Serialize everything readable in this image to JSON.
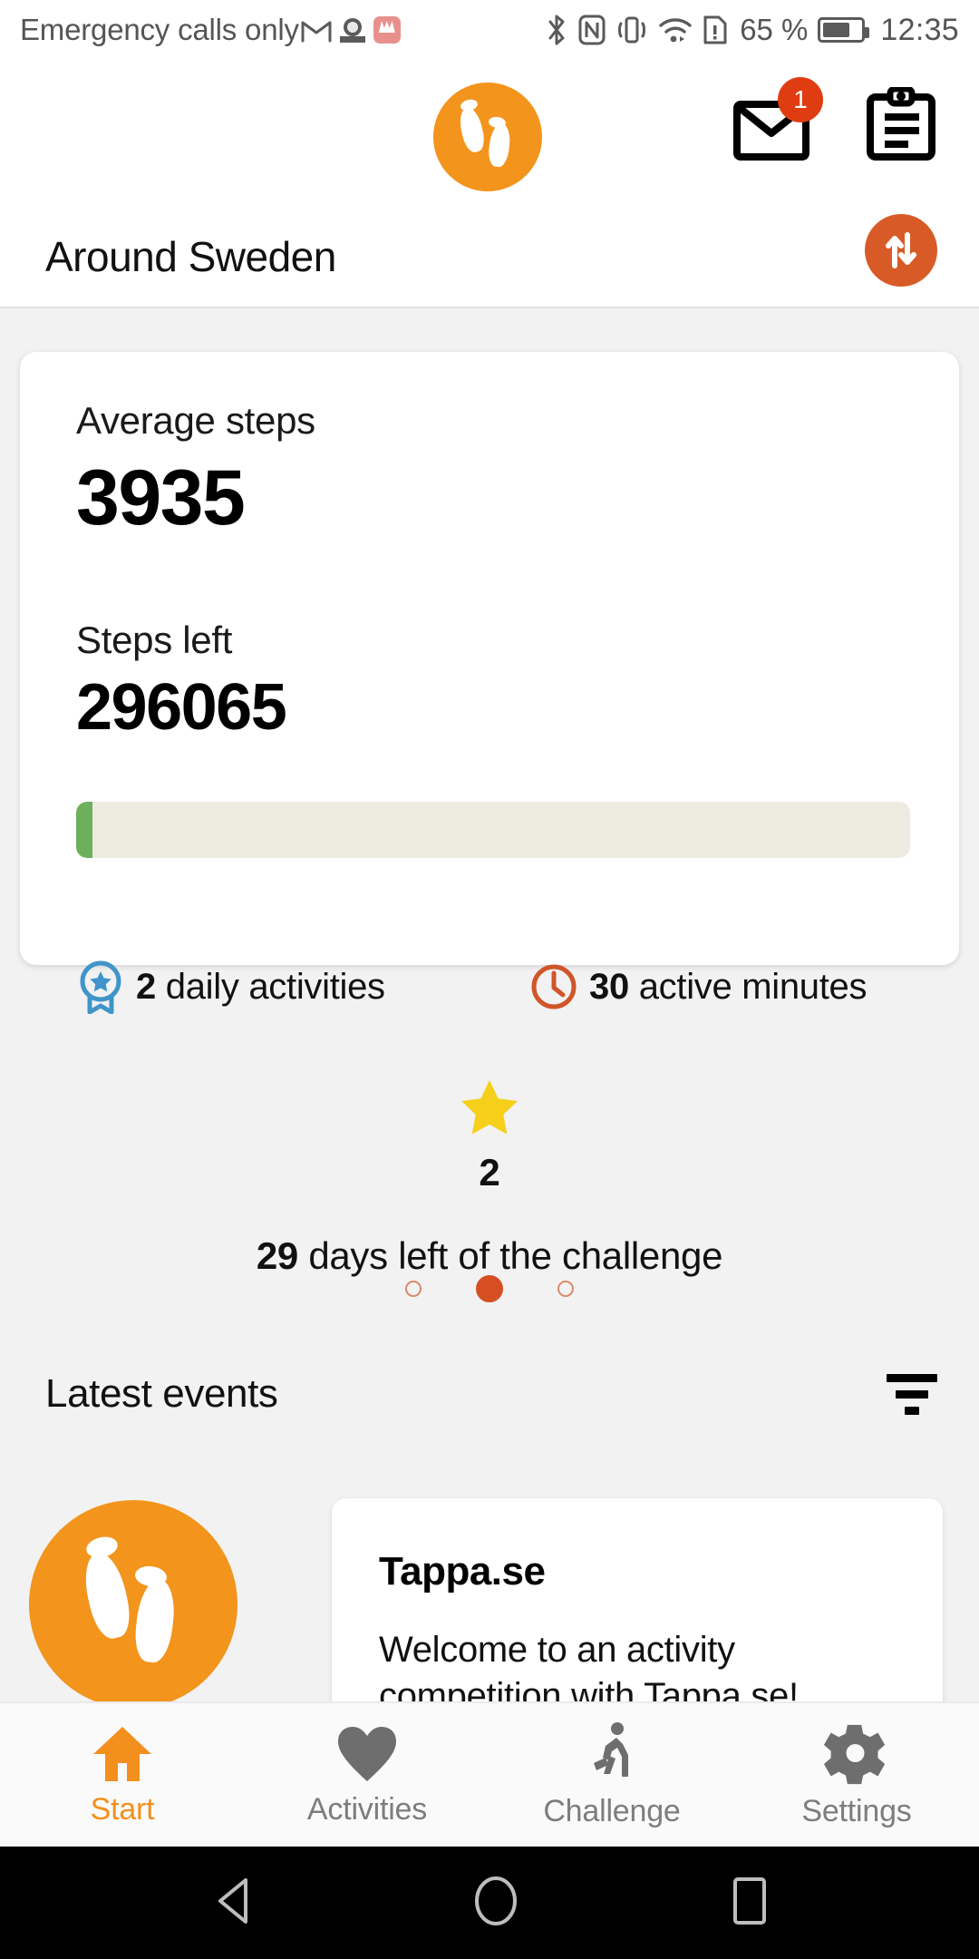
{
  "status_bar": {
    "carrier": "Emergency calls only",
    "left_icons": [
      "gmail-icon",
      "camera-icon",
      "huawei-icon"
    ],
    "right_icons": [
      "bluetooth-icon",
      "nfc-icon",
      "vibrate-icon",
      "wifi-icon",
      "sim-alert-icon"
    ],
    "battery_percent": "65 %",
    "battery_level": 65,
    "time": "12:35"
  },
  "header": {
    "logo_icon": "footprints-logo",
    "mail_icon": "mail-icon",
    "mail_badge": "1",
    "clipboard_icon": "clipboard-icon",
    "challenge_title": "Around Sweden",
    "sync_icon": "sync-arrows-icon"
  },
  "card": {
    "average_steps_label": "Average steps",
    "average_steps_value": "3935",
    "steps_left_label": "Steps left",
    "steps_left_value": "296065",
    "progress_percent": 2,
    "metrics": [
      {
        "icon": "award-ribbon-icon",
        "value": "2",
        "label": "daily activities",
        "color": "#3f95c9"
      },
      {
        "icon": "clock-icon",
        "value": "30",
        "label": "active minutes",
        "color": "#d0562a"
      }
    ],
    "star_icon": "star-icon",
    "star_count": "2",
    "days_left_value": "29",
    "days_left_label": "days left of the challenge",
    "pagination": {
      "total": 3,
      "active_index": 1,
      "active_color": "#d64f22"
    }
  },
  "events": {
    "section_title": "Latest events",
    "filter_icon": "filter-icon",
    "items": [
      {
        "avatar_icon": "footprints-logo",
        "title": "Tappa.se",
        "body": "Welcome to an activity competition with Tappa.se!"
      }
    ]
  },
  "bottom_nav": {
    "active_color": "#f3901d",
    "inactive_color": "#7d7d7d",
    "items": [
      {
        "icon": "home-icon",
        "label": "Start",
        "active": true
      },
      {
        "icon": "heart-icon",
        "label": "Activities",
        "active": false
      },
      {
        "icon": "running-person-icon",
        "label": "Challenge",
        "active": false
      },
      {
        "icon": "gear-icon",
        "label": "Settings",
        "active": false
      }
    ]
  },
  "android_nav": {
    "back_icon": "back-triangle-icon",
    "home_icon": "home-circle-icon",
    "recents_icon": "recents-square-icon"
  },
  "colors": {
    "brand_orange": "#f3941d",
    "accent_red": "#d64f22",
    "progress_green": "#6cb05c",
    "progress_track": "#edeae0",
    "page_bg": "#f2f2f2"
  }
}
